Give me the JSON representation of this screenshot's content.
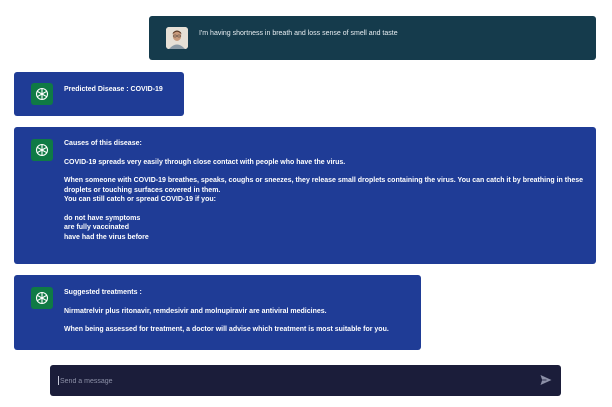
{
  "user_message": {
    "text": "I'm having shortness in breath and loss sense of smell and taste",
    "avatar_icon": "user-avatar"
  },
  "bot_icon": "chatgpt-logo-icon",
  "prediction": {
    "text": "Predicted Disease : COVID-19"
  },
  "causes": {
    "heading": "Causes of this disease:",
    "para1": "COVID-19 spreads very easily through close contact with people who have the virus.",
    "para2": "When someone with COVID-19 breathes, speaks, coughs or sneezes, they release small droplets containing the virus. You can catch it by breathing in these droplets or touching surfaces covered in them.",
    "para3": "You can still catch or spread COVID-19 if you:",
    "list": [
      "do not have symptoms",
      "are fully vaccinated",
      "have had the virus before"
    ]
  },
  "treatments": {
    "heading": "Suggested treatments :",
    "para1": "Nirmatrelvir plus ritonavir, remdesivir and molnupiravir are antiviral medicines.",
    "para2": "When being assessed for treatment, a doctor will advise which treatment is most suitable for you."
  },
  "composer": {
    "placeholder": "Send a message",
    "send_icon": "send-icon"
  },
  "colors": {
    "user_bubble": "#153b4c",
    "bot_bubble": "#1f3c96",
    "bot_icon_bg": "#0f7a45",
    "composer_bg": "#1b1d3a"
  }
}
